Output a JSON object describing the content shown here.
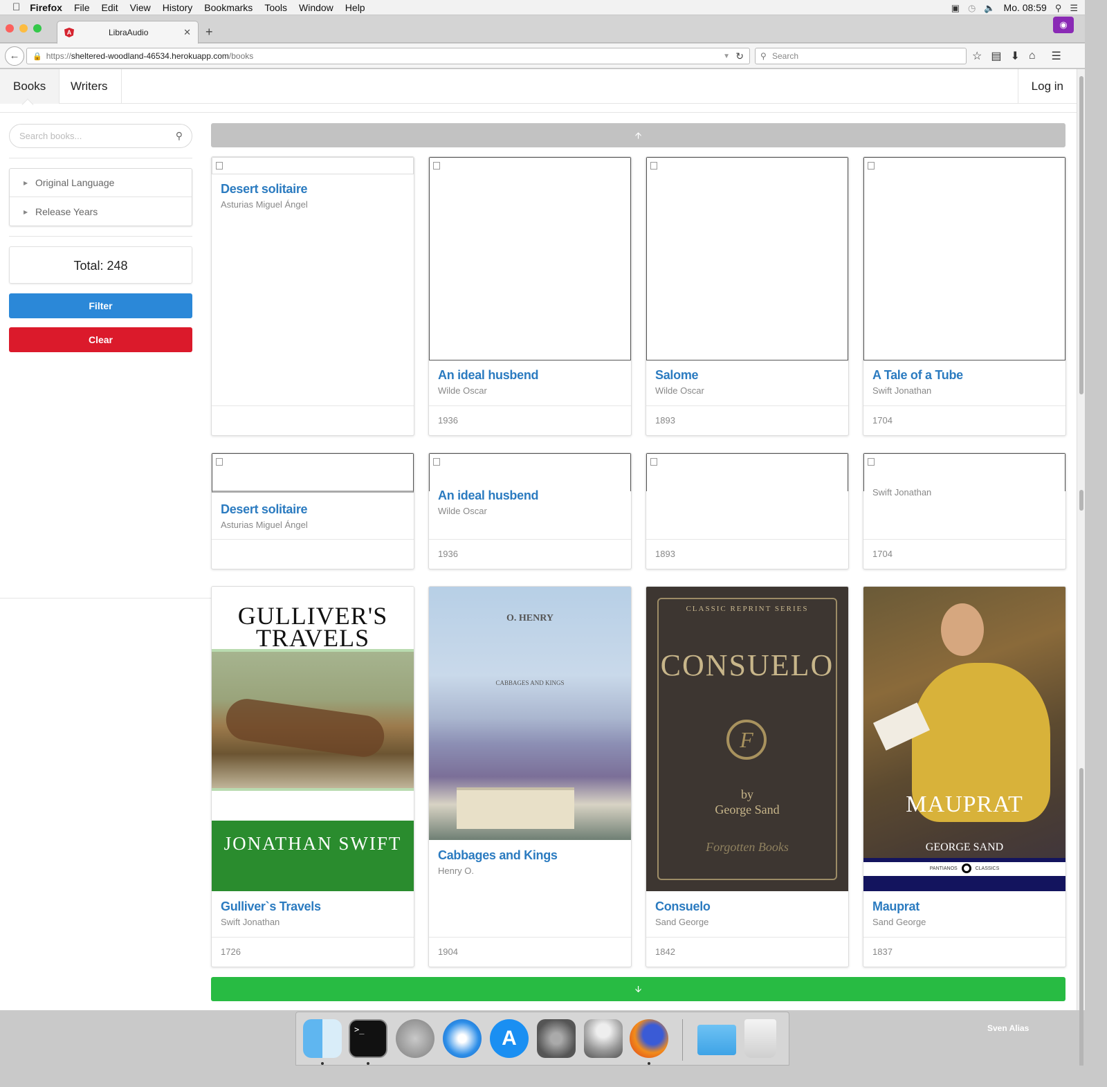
{
  "menubar": {
    "app": "Firefox",
    "items": [
      "File",
      "Edit",
      "View",
      "History",
      "Bookmarks",
      "Tools",
      "Window",
      "Help"
    ],
    "clock": "Mo. 08:59"
  },
  "browser": {
    "tab_title": "LibraAudio",
    "url_prefix": "https://",
    "url_host": "sheltered-woodland-46534.herokuapp.com",
    "url_path": "/books",
    "search_placeholder": "Search"
  },
  "app": {
    "nav": {
      "books": "Books",
      "writers": "Writers",
      "login": "Log in"
    },
    "sidebar": {
      "search_placeholder": "Search books...",
      "filters": [
        "Original Language",
        "Release Years"
      ],
      "total": "Total: 248",
      "filter_button": "Filter",
      "clear_button": "Clear"
    },
    "books_row1": [
      {
        "title": "Desert solitaire",
        "author": "Asturias Miguel Ángel",
        "year": ""
      },
      {
        "title": "An ideal husbend",
        "author": "Wilde Oscar",
        "year": "1936"
      },
      {
        "title": "Salome",
        "author": "Wilde Oscar",
        "year": "1893"
      },
      {
        "title": "A Tale of a Tube",
        "author": "Swift Jonathan",
        "year": "1704"
      }
    ],
    "books_row2": [
      {
        "title": "Desert solitaire",
        "author": "Asturias Miguel Ángel",
        "year": ""
      },
      {
        "title": "An ideal husbend",
        "author": "Wilde Oscar",
        "year": "1936"
      },
      {
        "title": "",
        "author": "",
        "year": "1893"
      },
      {
        "title": "",
        "author": "Swift Jonathan",
        "year": "1704"
      }
    ],
    "books_row3": [
      {
        "title": "Gulliver`s Travels",
        "author": "Swift Jonathan",
        "year": "1726"
      },
      {
        "title": "Cabbages and Kings",
        "author": "Henry O.",
        "year": "1904"
      },
      {
        "title": "Consuelo",
        "author": "Sand George",
        "year": "1842"
      },
      {
        "title": "Mauprat",
        "author": "Sand George",
        "year": "1837"
      }
    ],
    "covers": {
      "gulliver": {
        "title_l1": "GULLIVER'S",
        "title_l2": "TRAVELS",
        "author": "JONATHAN SWIFT"
      },
      "cabbages": {
        "author": "O. HENRY",
        "title": "CABBAGES AND KINGS"
      },
      "consuelo": {
        "series": "CLASSIC REPRINT SERIES",
        "title": "CONSUELO",
        "emblem": "F",
        "by": "by",
        "author": "George Sand",
        "publisher": "Forgotten Books"
      },
      "mauprat": {
        "title": "MAUPRAT",
        "author": "GEORGE SAND",
        "publisher_l": "PANTIANOS",
        "publisher_r": "CLASSICS"
      }
    }
  },
  "dock": {
    "user": "Sven Alias"
  },
  "colors": {
    "link": "#2b7bc0",
    "filter": "#2b88d8",
    "clear": "#db1a2b",
    "down": "#28bb43",
    "up": "#c2c2c2"
  }
}
